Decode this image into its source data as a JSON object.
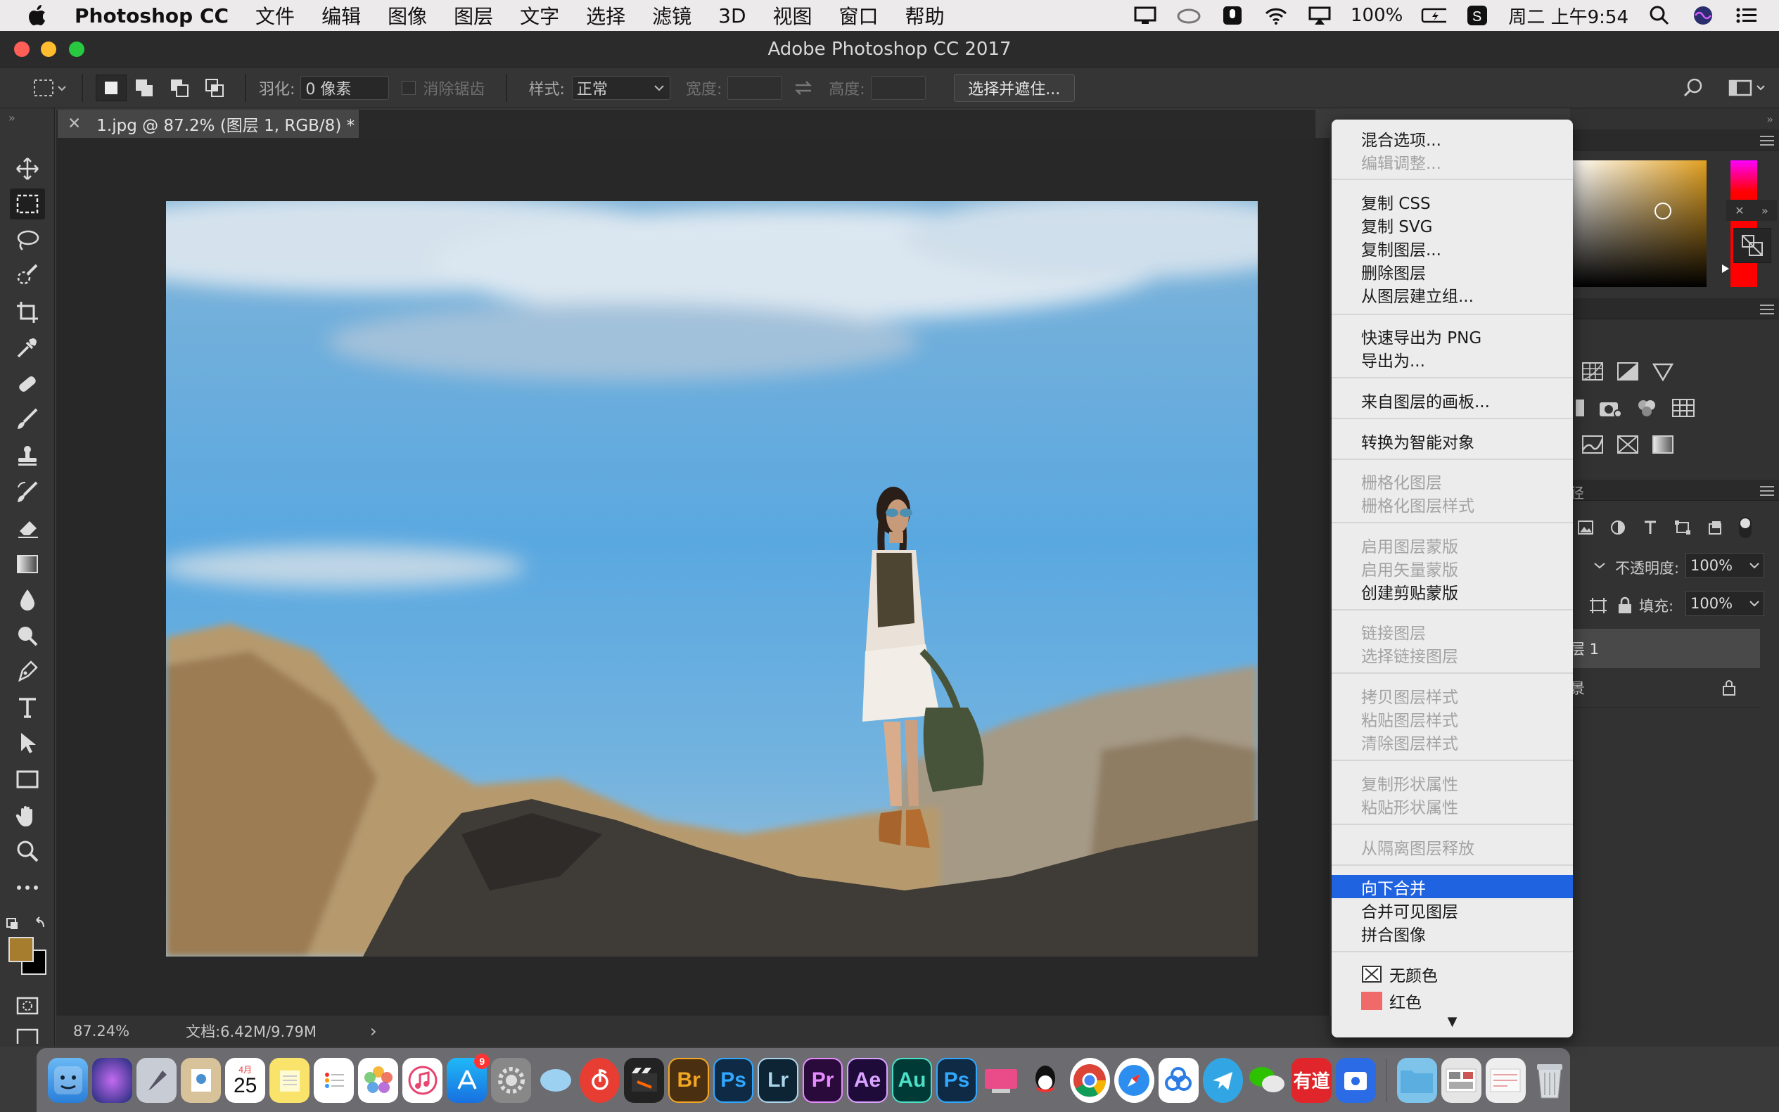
{
  "menubar": {
    "app_name": "Photoshop CC",
    "items": [
      "文件",
      "编辑",
      "图像",
      "图层",
      "文字",
      "选择",
      "滤镜",
      "3D",
      "视图",
      "窗口",
      "帮助"
    ],
    "battery": "100%",
    "clock": "周二 上午9:54"
  },
  "window": {
    "title": "Adobe Photoshop CC 2017"
  },
  "options": {
    "feather_label": "羽化:",
    "feather_value": "0 像素",
    "antialias_label": "消除锯齿",
    "style_label": "样式:",
    "style_value": "正常",
    "width_label": "宽度:",
    "height_label": "高度:",
    "select_mask_button": "选择并遮住..."
  },
  "document": {
    "tab_title": "1.jpg @ 87.2% (图层 1, RGB/8) *"
  },
  "status": {
    "zoom": "87.24%",
    "doc_size": "文档:6.42M/9.79M",
    "arrow": "›"
  },
  "layers": {
    "opacity_label": "不透明度:",
    "opacity_value": "100%",
    "fill_label": "填充:",
    "fill_value": "100%",
    "layer_partial": "层 1",
    "background_partial": "景",
    "paths_partial": "径"
  },
  "context_menu": {
    "blending_options": "混合选项...",
    "edit_adjustment": "编辑调整...",
    "copy_css": "复制 CSS",
    "copy_svg": "复制 SVG",
    "duplicate_layer": "复制图层...",
    "delete_layer": "删除图层",
    "group_from_layers": "从图层建立组...",
    "quick_export_png": "快速导出为 PNG",
    "export_as": "导出为...",
    "artboard_from_layers": "来自图层的画板...",
    "convert_smart_object": "转换为智能对象",
    "rasterize_layer": "栅格化图层",
    "rasterize_layer_style": "栅格化图层样式",
    "enable_layer_mask": "启用图层蒙版",
    "enable_vector_mask": "启用矢量蒙版",
    "create_clipping_mask": "创建剪贴蒙版",
    "link_layers": "链接图层",
    "select_linked_layers": "选择链接图层",
    "copy_layer_style": "拷贝图层样式",
    "paste_layer_style": "粘贴图层样式",
    "clear_layer_style": "清除图层样式",
    "copy_shape_attributes": "复制形状属性",
    "paste_shape_attributes": "粘贴形状属性",
    "release_from_isolation": "从隔离图层释放",
    "merge_down": "向下合并",
    "merge_visible": "合并可见图层",
    "flatten_image": "拼合图像",
    "no_color": "无颜色",
    "red": "红色",
    "scroll_arrow": "▼"
  },
  "dock": {
    "bridge": "Br",
    "photoshop": "Ps",
    "lightroom": "Lr",
    "premiere": "Pr",
    "after_effects": "Ae",
    "audition": "Au",
    "photoshop2": "Ps",
    "youdao": "有道",
    "calendar_day": "25",
    "calendar_month": "4月",
    "appstore_badge": "9"
  },
  "colors": {
    "highlight": "#1f63e1",
    "foreground_swatch": "#a67c2e",
    "red_swatch": "#f06a6a"
  }
}
